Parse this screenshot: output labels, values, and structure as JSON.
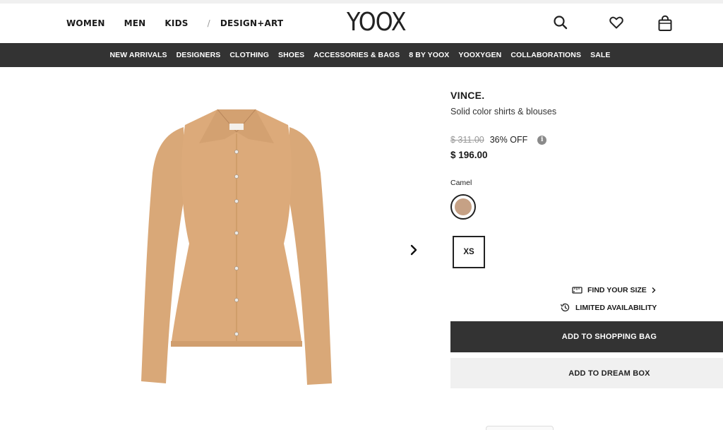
{
  "header": {
    "gender_nav": [
      {
        "label": "WOMEN",
        "active": true
      },
      {
        "label": "MEN",
        "active": false
      },
      {
        "label": "KIDS",
        "active": false
      }
    ],
    "separator": "/",
    "design_art": "DESIGN+ART",
    "logo": "YOOX",
    "icons": [
      "search-icon",
      "heart-icon",
      "shopping-bag-icon"
    ]
  },
  "category_nav": [
    "NEW ARRIVALS",
    "DESIGNERS",
    "CLOTHING",
    "SHOES",
    "ACCESSORIES & BAGS",
    "8 BY YOOX",
    "YOOXYGEN",
    "COLLABORATIONS",
    "SALE"
  ],
  "product": {
    "brand": "VINCE.",
    "subtitle": "Solid color shirts & blouses",
    "old_price": "$ 311.00",
    "discount": "36% OFF",
    "price": "$ 196.00",
    "color_label": "Camel",
    "color_hex": "#c6a185",
    "size": "XS",
    "find_size": "FIND YOUR SIZE",
    "limited": "LIMITED AVAILABILITY",
    "add_to_bag": "ADD TO SHOPPING BAG",
    "add_to_dream": "ADD TO DREAM BOX"
  },
  "colors": {
    "accent": "#f2e64a",
    "nav_bg": "#333333",
    "garment": "#d9a878"
  }
}
